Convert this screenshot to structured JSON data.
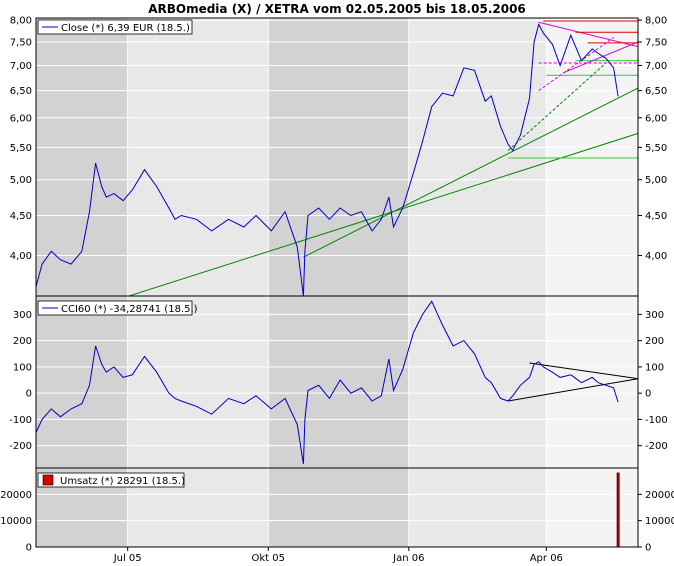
{
  "title": "ARBOmedia (X) / XETRA vom 02.05.2005 bis 18.05.2006",
  "x_axis": {
    "tick_labels": [
      "Jul 05",
      "Okt 05",
      "Jan 06",
      "Apr 06"
    ],
    "tick_dates": [
      "2005-07-01",
      "2005-10-01",
      "2006-01-01",
      "2006-04-01"
    ],
    "range": [
      "2005-05-02",
      "2006-05-31"
    ]
  },
  "colors": {
    "price_line": "#0000cc",
    "cci_line": "#0000cc",
    "trend_green": "#008800",
    "trend_magenta": "#dd00dd",
    "trend_red": "#dd0000",
    "trend_bright_green": "#33cc33",
    "cci_triangle": "#000000",
    "volume_bar": "#8b0000",
    "volume_legend": "#dd0000",
    "band_dark": "#d2d2d2",
    "band_light": "#e8e8e8",
    "band_white": "#f4f4f4"
  },
  "chart_data": [
    {
      "type": "line",
      "panel": "price",
      "legend": "Close (*) 6,39 EUR (18.5.)",
      "ylim": [
        3.55,
        8.05
      ],
      "log_scale": true,
      "y_ticks": [
        "4,00",
        "4,50",
        "5,00",
        "5,50",
        "6,00",
        "6,50",
        "7,00",
        "7,50",
        "8,00"
      ],
      "y_tick_values": [
        4.0,
        4.5,
        5.0,
        5.5,
        6.0,
        6.5,
        7.0,
        7.5,
        8.0
      ],
      "y_ticks_right": [
        "4,00",
        "4,50",
        "5,00",
        "5,50",
        "6,00",
        "6,50",
        "7,00",
        "7,50",
        "8,00"
      ],
      "series": [
        {
          "dates": [
            "2005-05-02",
            "2005-05-06",
            "2005-05-12",
            "2005-05-18",
            "2005-05-25",
            "2005-06-01",
            "2005-06-06",
            "2005-06-10",
            "2005-06-14",
            "2005-06-17",
            "2005-06-22",
            "2005-06-28",
            "2005-07-04",
            "2005-07-12",
            "2005-07-20",
            "2005-07-28",
            "2005-08-01",
            "2005-08-05",
            "2005-08-15",
            "2005-08-25",
            "2005-09-05",
            "2005-09-15",
            "2005-09-23",
            "2005-10-03",
            "2005-10-12",
            "2005-10-20",
            "2005-10-24",
            "2005-10-25",
            "2005-10-27",
            "2005-11-03",
            "2005-11-10",
            "2005-11-17",
            "2005-11-24",
            "2005-12-01",
            "2005-12-08",
            "2005-12-14",
            "2005-12-19",
            "2005-12-22",
            "2005-12-28",
            "2006-01-04",
            "2006-01-10",
            "2006-01-16",
            "2006-01-23",
            "2006-01-30",
            "2006-02-06",
            "2006-02-13",
            "2006-02-20",
            "2006-02-24",
            "2006-03-02",
            "2006-03-07",
            "2006-03-10",
            "2006-03-15",
            "2006-03-21",
            "2006-03-24",
            "2006-03-27",
            "2006-03-30",
            "2006-04-05",
            "2006-04-10",
            "2006-04-17",
            "2006-04-24",
            "2006-05-01",
            "2006-05-05",
            "2006-05-10",
            "2006-05-15",
            "2006-05-18"
          ],
          "values": [
            3.65,
            3.9,
            4.05,
            3.95,
            3.9,
            4.05,
            4.55,
            5.25,
            4.9,
            4.75,
            4.8,
            4.7,
            4.85,
            5.15,
            4.9,
            4.6,
            4.45,
            4.5,
            4.45,
            4.3,
            4.45,
            4.35,
            4.5,
            4.3,
            4.55,
            4.1,
            3.55,
            4.05,
            4.5,
            4.6,
            4.45,
            4.6,
            4.5,
            4.55,
            4.3,
            4.45,
            4.75,
            4.35,
            4.6,
            5.1,
            5.6,
            6.2,
            6.45,
            6.4,
            6.95,
            6.9,
            6.3,
            6.4,
            5.85,
            5.55,
            5.45,
            5.7,
            6.35,
            7.5,
            7.9,
            7.7,
            7.45,
            7.0,
            7.65,
            7.1,
            7.35,
            7.25,
            7.15,
            6.95,
            6.39
          ]
        }
      ],
      "trendlines": [
        {
          "name": "long-trend-low",
          "color": "trend_green",
          "dash": false,
          "x1": "2005-06-22",
          "y1": 3.5,
          "x2": "2006-05-31",
          "y2": 5.73
        },
        {
          "name": "long-trend-high",
          "color": "trend_green",
          "dash": false,
          "x1": "2005-10-24",
          "y1": 3.98,
          "x2": "2006-05-31",
          "y2": 6.55
        },
        {
          "name": "march-support",
          "color": "trend_bright_green",
          "dash": false,
          "x1": "2006-03-07",
          "y1": 5.33,
          "x2": "2006-05-31",
          "y2": 5.33
        },
        {
          "name": "support-6-80",
          "color": "trend_bright_green",
          "dash": false,
          "x1": "2006-04-01",
          "y1": 6.8,
          "x2": "2006-05-31",
          "y2": 6.8
        },
        {
          "name": "support-7-10",
          "color": "trend_bright_green",
          "dash": false,
          "x1": "2006-04-20",
          "y1": 7.1,
          "x2": "2006-05-31",
          "y2": 7.1
        },
        {
          "name": "uptrend-dashed",
          "color": "trend_green",
          "dash": true,
          "x1": "2006-03-07",
          "y1": 5.45,
          "x2": "2006-05-10",
          "y2": 7.05
        },
        {
          "name": "triangle-upper",
          "color": "trend_magenta",
          "dash": false,
          "x1": "2006-03-27",
          "y1": 7.95,
          "x2": "2006-05-31",
          "y2": 7.4
        },
        {
          "name": "triangle-lower",
          "color": "trend_magenta",
          "dash": false,
          "x1": "2006-04-12",
          "y1": 6.85,
          "x2": "2006-05-31",
          "y2": 7.5
        },
        {
          "name": "magenta-dashed",
          "color": "trend_magenta",
          "dash": true,
          "x1": "2006-03-27",
          "y1": 6.5,
          "x2": "2006-05-15",
          "y2": 7.6
        },
        {
          "name": "magenta-level",
          "color": "trend_magenta",
          "dash": true,
          "x1": "2006-03-27",
          "y1": 7.05,
          "x2": "2006-05-31",
          "y2": 7.05
        },
        {
          "name": "resistance-8-00",
          "color": "trend_red",
          "dash": false,
          "x1": "2006-03-30",
          "y1": 7.98,
          "x2": "2006-05-31",
          "y2": 7.98
        },
        {
          "name": "resistance-7-72",
          "color": "trend_red",
          "dash": false,
          "x1": "2006-04-20",
          "y1": 7.72,
          "x2": "2006-05-31",
          "y2": 7.72
        },
        {
          "name": "resistance-7-48",
          "color": "trend_red",
          "dash": false,
          "x1": "2006-04-28",
          "y1": 7.48,
          "x2": "2006-05-31",
          "y2": 7.48
        }
      ]
    },
    {
      "type": "line",
      "panel": "cci",
      "legend": "CCI60 (*) -34,28741 (18.5.)",
      "ylim": [
        -285,
        370
      ],
      "y_ticks": [
        "-200",
        "-100",
        "0",
        "100",
        "200",
        "300"
      ],
      "y_tick_values": [
        -200,
        -100,
        0,
        100,
        200,
        300
      ],
      "series": [
        {
          "dates": [
            "2005-05-02",
            "2005-05-06",
            "2005-05-12",
            "2005-05-18",
            "2005-05-25",
            "2005-06-01",
            "2005-06-06",
            "2005-06-10",
            "2005-06-14",
            "2005-06-17",
            "2005-06-22",
            "2005-06-28",
            "2005-07-04",
            "2005-07-12",
            "2005-07-20",
            "2005-07-28",
            "2005-08-01",
            "2005-08-05",
            "2005-08-15",
            "2005-08-25",
            "2005-09-05",
            "2005-09-15",
            "2005-09-23",
            "2005-10-03",
            "2005-10-12",
            "2005-10-20",
            "2005-10-24",
            "2005-10-25",
            "2005-10-27",
            "2005-11-03",
            "2005-11-10",
            "2005-11-17",
            "2005-11-24",
            "2005-12-01",
            "2005-12-08",
            "2005-12-14",
            "2005-12-19",
            "2005-12-22",
            "2005-12-28",
            "2006-01-04",
            "2006-01-10",
            "2006-01-16",
            "2006-01-23",
            "2006-01-30",
            "2006-02-06",
            "2006-02-13",
            "2006-02-20",
            "2006-02-24",
            "2006-03-02",
            "2006-03-07",
            "2006-03-10",
            "2006-03-15",
            "2006-03-21",
            "2006-03-24",
            "2006-03-27",
            "2006-03-30",
            "2006-04-05",
            "2006-04-10",
            "2006-04-17",
            "2006-04-24",
            "2006-05-01",
            "2006-05-05",
            "2006-05-10",
            "2006-05-15",
            "2006-05-18"
          ],
          "values": [
            -150,
            -100,
            -60,
            -90,
            -60,
            -40,
            30,
            180,
            110,
            80,
            100,
            60,
            70,
            140,
            80,
            0,
            -20,
            -30,
            -50,
            -80,
            -20,
            -40,
            -10,
            -60,
            -20,
            -120,
            -270,
            -100,
            10,
            30,
            -20,
            50,
            0,
            20,
            -30,
            -10,
            130,
            10,
            90,
            230,
            300,
            350,
            260,
            180,
            200,
            150,
            60,
            40,
            -20,
            -30,
            -10,
            30,
            60,
            110,
            120,
            100,
            80,
            60,
            70,
            40,
            60,
            40,
            30,
            20,
            -34
          ]
        }
      ],
      "trendlines": [
        {
          "name": "cci-upper",
          "color": "cci_triangle",
          "x1": "2006-03-21",
          "y1": 115,
          "x2": "2006-05-31",
          "y2": 55
        },
        {
          "name": "cci-lower",
          "color": "cci_triangle",
          "x1": "2006-03-07",
          "y1": -30,
          "x2": "2006-05-31",
          "y2": 55
        }
      ]
    },
    {
      "type": "bar",
      "panel": "volume",
      "legend": "Umsatz (*) 28291 (18.5.)",
      "ylim": [
        0,
        30000
      ],
      "y_ticks": [
        "0",
        "10000",
        "20000"
      ],
      "y_tick_values": [
        0,
        10000,
        20000
      ],
      "bars": [
        {
          "date": "2006-05-18",
          "value": 28291
        }
      ]
    }
  ]
}
